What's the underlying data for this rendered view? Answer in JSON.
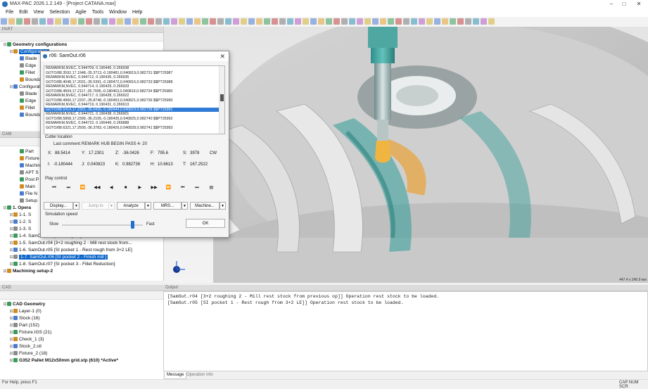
{
  "window": {
    "title": "MAX-PAC 2026.1.2.149 - [Project CATANA.max]",
    "minimize": "–",
    "maximize": "□",
    "close": "✕"
  },
  "menu": [
    "File",
    "Edit",
    "View",
    "Selection",
    "Agile",
    "Tools",
    "Window",
    "Help"
  ],
  "part_panel": {
    "header": "PART",
    "rows": [
      {
        "label": "Geometry configurations",
        "bold": true,
        "indent": 0
      },
      {
        "label": "Configuration",
        "selected": true,
        "indent": 1
      },
      {
        "label": "Blade",
        "indent": 2
      },
      {
        "label": "Edge",
        "indent": 2
      },
      {
        "label": "Fillet",
        "indent": 2
      },
      {
        "label": "Boundary",
        "indent": 2
      },
      {
        "label": "Configuration",
        "indent": 1
      },
      {
        "label": "Blade",
        "indent": 2
      },
      {
        "label": "Edge",
        "indent": 2
      },
      {
        "label": "Fillet",
        "indent": 2
      },
      {
        "label": "Boundary",
        "indent": 2
      }
    ]
  },
  "cam_panel": {
    "header": "CAM",
    "rows": [
      {
        "label": "Part",
        "indent": 2
      },
      {
        "label": "Fixture",
        "indent": 2
      },
      {
        "label": "Machine",
        "indent": 2
      },
      {
        "label": "APT S",
        "indent": 2
      },
      {
        "label": "Post P",
        "indent": 2
      },
      {
        "label": "Main",
        "indent": 2
      },
      {
        "label": "File N",
        "indent": 2
      },
      {
        "label": "Setup",
        "indent": 2
      },
      {
        "label": "1. Opera",
        "bold": true,
        "indent": 0
      },
      {
        "label": "1-1. S",
        "indent": 1
      },
      {
        "label": "1-2. S",
        "indent": 1
      },
      {
        "label": "1-3. S",
        "indent": 1
      },
      {
        "label": "1-4. SamOut.r03 [3+2 roughing 1 - Mill rest stock from...",
        "indent": 1
      },
      {
        "label": "1-5. SamOut.r04 [3+2 roughing 2 - Mill rest stock from...",
        "indent": 1
      },
      {
        "label": "1-6. SamOut.r05 [SI pocket 1 - Rest rough from 3+2 LE]",
        "indent": 1
      },
      {
        "label": "1-7. SamOut.r06 [SI pocket 2 - Finish mill ]",
        "indent": 1,
        "selected": true
      },
      {
        "label": "1-8. SamOut.r07 [SI pocket 3 - Fillet Reduction]",
        "indent": 1
      },
      {
        "label": "Machining setup-2",
        "bold": true,
        "indent": 0
      }
    ]
  },
  "cad_panel": {
    "header": "CAD",
    "rows": [
      {
        "label": "CAD Geometry",
        "bold": true,
        "indent": 0
      },
      {
        "label": "Layer-1 (0)",
        "indent": 1
      },
      {
        "label": "Stock (16)",
        "indent": 1
      },
      {
        "label": "Part (152)",
        "indent": 1
      },
      {
        "label": "Fixture.IGS (21)",
        "indent": 1
      },
      {
        "label": "Check_1 (3)",
        "indent": 1
      },
      {
        "label": "Stock_2.stl",
        "indent": 1
      },
      {
        "label": "Fixture_2 (18)",
        "indent": 1
      },
      {
        "label": "G352 Pallet M12x50mm grid.stp (610) *Active*",
        "bold": true,
        "indent": 1
      }
    ]
  },
  "dialog": {
    "title": "r06: SamOut.r06",
    "close": "✕",
    "code_lines": [
      "REMARKM,NVEC, 0.944709, 0.190445, 0.266938",
      "GOTO/88.3592,17.1948,-35.3713,-0.180481,0.040819,0.982731 $$PT25987",
      "REMARKM,NVEC, 0.944712, 0.190435, 0.266935",
      "GOTO/88.4048,17.2031,-35.5391,-0.180472,0.040816,0.982733 $$PT25988",
      "REMARKM,NVEC, 0.944714, 0.190429, 0.266933",
      "GOTO/88.4504,17.2117,-35.7095,-0.180463,0.040819,0.982734 $$PT25989",
      "REMARKM,NVEC, 0.944717, 0.190428, 0.266922",
      "GOTO/88.4960,17.2207,-35.8748,-0.180453,0.040821,0.982736 $$PT25990",
      "REMARKM,NVEC, 0.944719, 0.190431, 0.266913",
      "GOTO/88.5414,17.2301,-36.0426,-0.180444,0.040823,0.982738 $$PT25991",
      "REMARKM,NVEC, 0.944721, 0.190438, 0.266901",
      "GOTO/88.5868,17.2399,-36.2105,-0.180435,0.040825,0.982740 $$PT25992",
      "REMARKM,NVEC, 0.944722, 0.190449, 0.266888",
      "GOTO/88.6321,17.2500,-36.3783,-0.180426,0.040828,0.982741 $$PT25993"
    ],
    "highlight_index": 9,
    "cutter_location_label": "Cutter location",
    "last_comment_label": "Last comment:",
    "last_comment": "REMARK HUB BEGIN PASS   4- 20",
    "fields": {
      "x_label": "X:",
      "x": "88.5414",
      "y_label": "Y:",
      "y": "17.2301",
      "z_label": "Z:",
      "z": "-36.0426",
      "f_label": "F:",
      "f": "795.6",
      "s_label": "S:",
      "s": "3978",
      "dir": "CW",
      "i_label": "I:",
      "i": "-0.180444",
      "j_label": "J:",
      "j": "0.040823",
      "k_label": "K:",
      "k": "0.982738",
      "h_label": "H:",
      "h": "10.6613",
      "t_label": "T:",
      "t": "167.2522"
    },
    "play_control_label": "Play control",
    "play_buttons": [
      "⏮",
      "⏭",
      "⏪",
      "◀◀",
      "◀",
      "■",
      "▶",
      "▶▶",
      "⏩",
      "⏮",
      "⏭",
      "▤"
    ],
    "display_label": "Display...",
    "jump_to_label": "Jump to",
    "analyze_label": "Analyze",
    "mrs_label": "MRS...",
    "machine_label": "Machine...",
    "sim_speed_label": "Simulation speed",
    "slow_label": "Slow",
    "fast_label": "Fast",
    "ok_label": "OK",
    "speed_value": 0.87
  },
  "viewport": {
    "size_readout": "447.4 x 245.9 ww"
  },
  "output": {
    "header": "Output",
    "lines": [
      "[SamOut.r04 [3+2 roughing 2 - Mill rest stock from previous op]] Operation rest stock to be loaded.",
      "[SamOut.r05 [SI pocket 1 - Rest rough from 3+2 LE]] Operation rest stock to be loaded."
    ],
    "tabs": [
      "Message",
      "Operation info"
    ]
  },
  "status": {
    "left": "For Help, press F1",
    "right": "CAP NUM SCR"
  }
}
